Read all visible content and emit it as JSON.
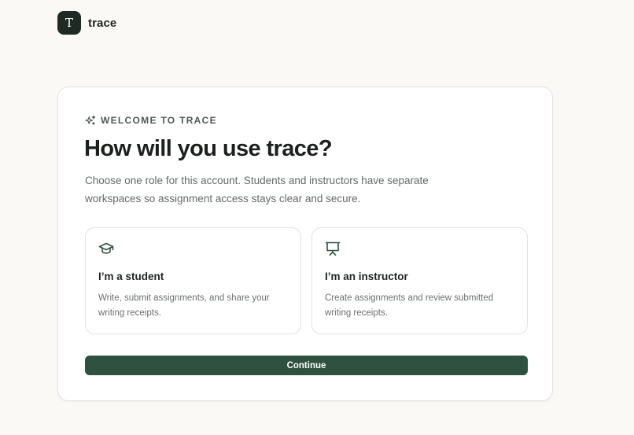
{
  "brand": {
    "logo_letter": "T",
    "name": "trace"
  },
  "card": {
    "eyebrow": "WELCOME TO TRACE",
    "eyebrow_icon": "sparkles-icon",
    "title": "How will you use trace?",
    "subtitle": "Choose one role for this account. Students and instructors have separate workspaces so assignment access stays clear and secure."
  },
  "roles": [
    {
      "icon": "graduation-cap-icon",
      "title": "I’m a student",
      "description": "Write, submit assignments, and share your writing receipts."
    },
    {
      "icon": "presentation-board-icon",
      "title": "I’m an instructor",
      "description": "Create assignments and review submitted writing receipts."
    }
  ],
  "actions": {
    "continue_label": "Continue"
  },
  "colors": {
    "accent": "#2f5240",
    "logo_bg": "#1e2a23",
    "page_bg": "#faf9f6"
  }
}
